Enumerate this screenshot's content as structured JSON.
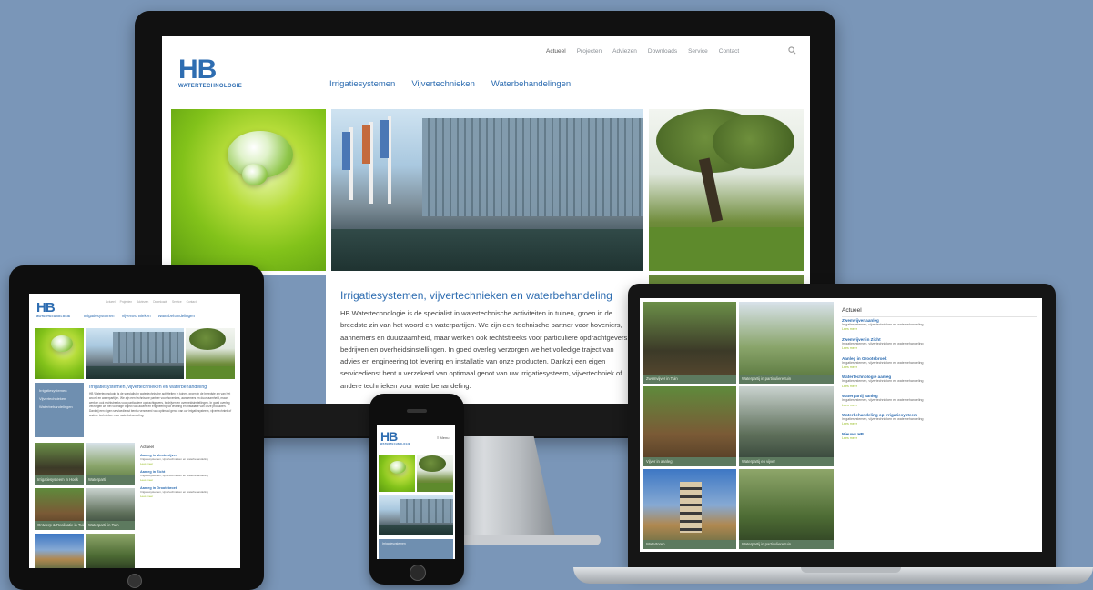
{
  "brand": {
    "logo_text": "HB",
    "logo_sub": "WATERTECHNOLOGIE",
    "accent": "#2e6db1",
    "green": "#9abf2a",
    "background": "#7a96b8"
  },
  "desktop": {
    "top_links": [
      "Actueel",
      "Projecten",
      "Adviezen",
      "Downloads",
      "Service",
      "Contact"
    ],
    "search_icon": "search-icon",
    "nav": [
      "Irrigatiesystemen",
      "Vijvertechnieken",
      "Waterbehandelingen"
    ],
    "article_title": "Irrigatiesystemen, vijvertechnieken en waterbehandeling",
    "article_body": "HB Watertechnologie is de specialist in watertechnische activiteiten in tuinen, groen in de breedste zin van het woord en waterpartijen. We zijn een technische partner voor hoveniers, aannemers en duurzaamheid, maar werken ook rechtstreeks voor particuliere opdrachtgevers, bedrijven en overheidsinstellingen. In goed overleg verzorgen we het volledige traject van advies en engineering tot levering en installatie van onze producten. Dankzij een eigen servicedienst bent u verzekerd van optimaal genot van uw irrigatiesysteem, vijvertechniek of andere technieken voor waterbehandeling."
  },
  "tablet": {
    "side_links": [
      "Irrigatiesystemen",
      "Vijvertechnieken",
      "Waterbehandelingen"
    ],
    "captions": [
      "Irrigatiesysteem in Hoek",
      "Waterpartij",
      "Ontwerp & Realisatie in Tuin",
      "Waterpartij in Tuin",
      "",
      ""
    ],
    "news_header": "Actueel",
    "news": [
      {
        "title": "Aanleg in sleutelvijver",
        "more": "Lees meer"
      },
      {
        "title": "Aanleg in Zicht",
        "more": "Lees meer"
      },
      {
        "title": "Aanleg in Grootebroek",
        "more": "Lees meer"
      }
    ]
  },
  "phone": {
    "logo_text": "HB",
    "menu_label": "≡ Menu"
  },
  "laptop": {
    "captions": [
      "Zwemvijver in Tuin",
      "Waterpartij in particuliere tuin",
      "Vijver in aanleg",
      "Waterpartij en vijver",
      "Watertoren",
      "Waterpartij in particuliere tuin"
    ],
    "news_header": "Actueel",
    "news": [
      {
        "title": "Zwemvijver aanleg",
        "more": "Lees meer"
      },
      {
        "title": "Zwemvijver in Zicht",
        "more": "Lees meer"
      },
      {
        "title": "Aanleg in Grootebroek",
        "more": "Lees meer"
      },
      {
        "title": "Watertechnologie aanleg",
        "more": "Lees meer"
      },
      {
        "title": "Waterpartij aanleg",
        "more": "Lees meer"
      },
      {
        "title": "Waterbehandeling op irrigatiesysteem",
        "more": "Lees meer"
      },
      {
        "title": "Nieuws HB",
        "more": "Lees meer"
      }
    ]
  }
}
